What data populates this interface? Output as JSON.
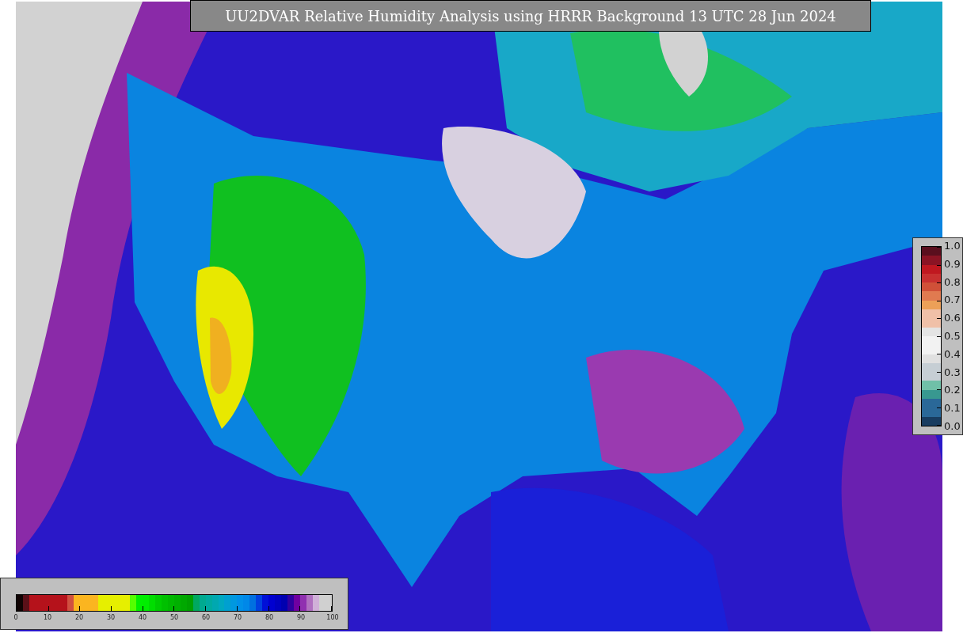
{
  "title": "UU2DVAR Relative Humidity Analysis using HRRR Background 13 UTC 28 Jun 2024",
  "humidity_colorbar": {
    "segments": [
      {
        "color": "#100404"
      },
      {
        "color": "#5a1018"
      },
      {
        "color": "#b5121b"
      },
      {
        "color": "#b5121b"
      },
      {
        "color": "#b5121b"
      },
      {
        "color": "#b5121b"
      },
      {
        "color": "#b5121b"
      },
      {
        "color": "#b5121b"
      },
      {
        "color": "#d05040"
      },
      {
        "color": "#fbb520"
      },
      {
        "color": "#fbb520"
      },
      {
        "color": "#fbb520"
      },
      {
        "color": "#fbb520"
      },
      {
        "color": "#e6ef00"
      },
      {
        "color": "#e6ef00"
      },
      {
        "color": "#e6ef00"
      },
      {
        "color": "#e6ef00"
      },
      {
        "color": "#e6ef00"
      },
      {
        "color": "#55ff00"
      },
      {
        "color": "#00f000"
      },
      {
        "color": "#00ee00"
      },
      {
        "color": "#00dd00"
      },
      {
        "color": "#00cc00"
      },
      {
        "color": "#00c000"
      },
      {
        "color": "#00b800"
      },
      {
        "color": "#00b000"
      },
      {
        "color": "#00a800"
      },
      {
        "color": "#00a000"
      },
      {
        "color": "#00a860"
      },
      {
        "color": "#00aa90"
      },
      {
        "color": "#00aaa0"
      },
      {
        "color": "#00a8b0"
      },
      {
        "color": "#00a8c0"
      },
      {
        "color": "#00a0d0"
      },
      {
        "color": "#0098e0"
      },
      {
        "color": "#0090e8"
      },
      {
        "color": "#0088e8"
      },
      {
        "color": "#0070e0"
      },
      {
        "color": "#0040e0"
      },
      {
        "color": "#0010d8"
      },
      {
        "color": "#0000d0"
      },
      {
        "color": "#0000c0"
      },
      {
        "color": "#0000b0"
      },
      {
        "color": "#3000a0"
      },
      {
        "color": "#7000a0"
      },
      {
        "color": "#9030b0"
      },
      {
        "color": "#b070c0"
      },
      {
        "color": "#d0b0d8"
      },
      {
        "color": "#d0d0d0"
      },
      {
        "color": "#d0d0d0"
      }
    ],
    "ticks": [
      "0",
      "10",
      "20",
      "30",
      "40",
      "50",
      "60",
      "70",
      "80",
      "90",
      "100"
    ]
  },
  "station_colorbar": {
    "segments": [
      {
        "color": "#5a0f1e"
      },
      {
        "color": "#8b1424"
      },
      {
        "color": "#c01820"
      },
      {
        "color": "#c83030"
      },
      {
        "color": "#d05038"
      },
      {
        "color": "#e07a50"
      },
      {
        "color": "#eca058"
      },
      {
        "color": "#f0c0a8"
      },
      {
        "color": "#f0c0a8"
      },
      {
        "color": "#e4e4e4"
      },
      {
        "color": "#f2f2f2"
      },
      {
        "color": "#f2f2f2"
      },
      {
        "color": "#e0e0e0"
      },
      {
        "color": "#c6ced4"
      },
      {
        "color": "#c6ced4"
      },
      {
        "color": "#70c0a8"
      },
      {
        "color": "#389890"
      },
      {
        "color": "#2a6898"
      },
      {
        "color": "#2a6898"
      },
      {
        "color": "#183c60"
      }
    ],
    "ticks": [
      "1.0",
      "0.9",
      "0.8",
      "0.7",
      "0.6",
      "0.5",
      "0.4",
      "0.3",
      "0.2",
      "0.1",
      "0.0"
    ]
  }
}
